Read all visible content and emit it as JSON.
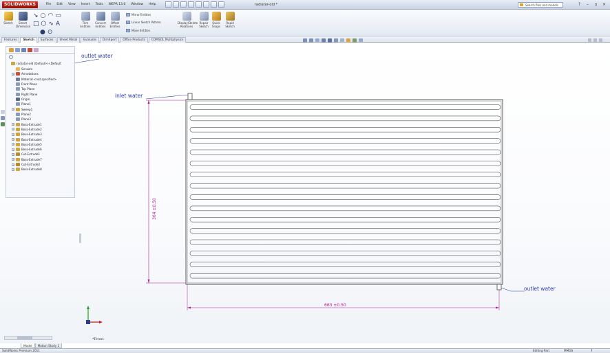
{
  "app": {
    "logo": "SOLIDWORKS",
    "menus": [
      "File",
      "Edit",
      "View",
      "Insert",
      "Tools",
      "WEPR 13.0",
      "Window",
      "Help"
    ],
    "document_title": "radiator-old *",
    "search_placeholder": "Search files and models",
    "window_controls": [
      "?",
      "–",
      "▫",
      "×"
    ]
  },
  "ribbon": {
    "sketch_label": "Sketch",
    "smart_dimension_label": "Smart Dimension",
    "trim_label": "Trim Entities",
    "convert_label": "Convert Entities",
    "offset_label": "Offset Entities",
    "mirror_label": "Mirror Entities",
    "linear_pattern_label": "Linear Sketch Pattern",
    "move_label": "Move Entities",
    "display_relations_label": "Display/Delete Relations",
    "repair_label": "Repair Sketch",
    "quick_snaps_label": "Quick Snaps",
    "rapid_sketch_label": "Rapid Sketch"
  },
  "tabs": [
    "Features",
    "Sketch",
    "Surfaces",
    "Sheet Metal",
    "Evaluate",
    "DimXpert",
    "Office Products",
    "COMSOL Multiphysics"
  ],
  "active_tab": "Sketch",
  "feature_tree": {
    "root": "radiator-old  (Default<<Default",
    "items": [
      {
        "label": "Sensors",
        "icon": "folder-icon",
        "color": "#e8b84a",
        "expandable": false
      },
      {
        "label": "Annotations",
        "icon": "annotation-icon",
        "color": "#d04b3a",
        "expandable": true
      },
      {
        "label": "Material <not specified>",
        "icon": "material-icon",
        "color": "#6c7c9a",
        "expandable": false
      },
      {
        "label": "Front Plane",
        "icon": "plane-icon",
        "color": "#8a9bb8",
        "expandable": false
      },
      {
        "label": "Top Plane",
        "icon": "plane-icon",
        "color": "#8a9bb8",
        "expandable": false
      },
      {
        "label": "Right Plane",
        "icon": "plane-icon",
        "color": "#8a9bb8",
        "expandable": false
      },
      {
        "label": "Origin",
        "icon": "origin-icon",
        "color": "#5a6a8a",
        "expandable": false
      },
      {
        "label": "Plane1",
        "icon": "plane-icon",
        "color": "#8a9bb8",
        "expandable": false
      },
      {
        "label": "Sweep1",
        "icon": "sweep-icon",
        "color": "#d0a334",
        "expandable": true
      },
      {
        "label": "Plane2",
        "icon": "plane-icon",
        "color": "#8a9bb8",
        "expandable": false
      },
      {
        "label": "Plane3",
        "icon": "plane-icon",
        "color": "#8a9bb8",
        "expandable": false
      },
      {
        "label": "Boss-Extrude1",
        "icon": "extrude-icon",
        "color": "#d4a63a",
        "expandable": true
      },
      {
        "label": "Boss-Extrude2",
        "icon": "extrude-icon",
        "color": "#d4a63a",
        "expandable": true
      },
      {
        "label": "Boss-Extrude3",
        "icon": "extrude-icon",
        "color": "#d4a63a",
        "expandable": true
      },
      {
        "label": "Boss-Extrude4",
        "icon": "extrude-icon",
        "color": "#d4a63a",
        "expandable": true
      },
      {
        "label": "Boss-Extrude5",
        "icon": "extrude-icon",
        "color": "#d4a63a",
        "expandable": true
      },
      {
        "label": "Boss-Extrude6",
        "icon": "extrude-icon",
        "color": "#d4a63a",
        "expandable": true
      },
      {
        "label": "Cut-Extrude1",
        "icon": "cut-icon",
        "color": "#b88a2a",
        "expandable": true
      },
      {
        "label": "Boss-Extrude7",
        "icon": "extrude-icon",
        "color": "#d4a63a",
        "expandable": true
      },
      {
        "label": "Cut-Extrude2",
        "icon": "cut-icon",
        "color": "#b88a2a",
        "expandable": true
      },
      {
        "label": "Boss-Extrude8",
        "icon": "extrude-icon",
        "color": "#d4a63a",
        "expandable": true
      }
    ]
  },
  "drawing": {
    "notes": {
      "outlet_top": "outlet water",
      "inlet": "inlet water",
      "outlet_bottom": "outlet water"
    },
    "dimensions": {
      "height": "364 ±0.50",
      "width": "663 ±0.50"
    },
    "tube_count": 16,
    "view_label": "*Front",
    "dimension_color": "#b5189a",
    "note_color": "#2c3ea8",
    "axis_colors": {
      "x": "#c02020",
      "y": "#20a020"
    }
  },
  "bottom": {
    "model_tabs": [
      "Model",
      "Motion Study 1"
    ],
    "active_model_tab": "Model",
    "status_left": "SolidWorks Premium 2011",
    "status_mode": "Editing Part",
    "status_units": "MMGS",
    "status_help": "?"
  }
}
